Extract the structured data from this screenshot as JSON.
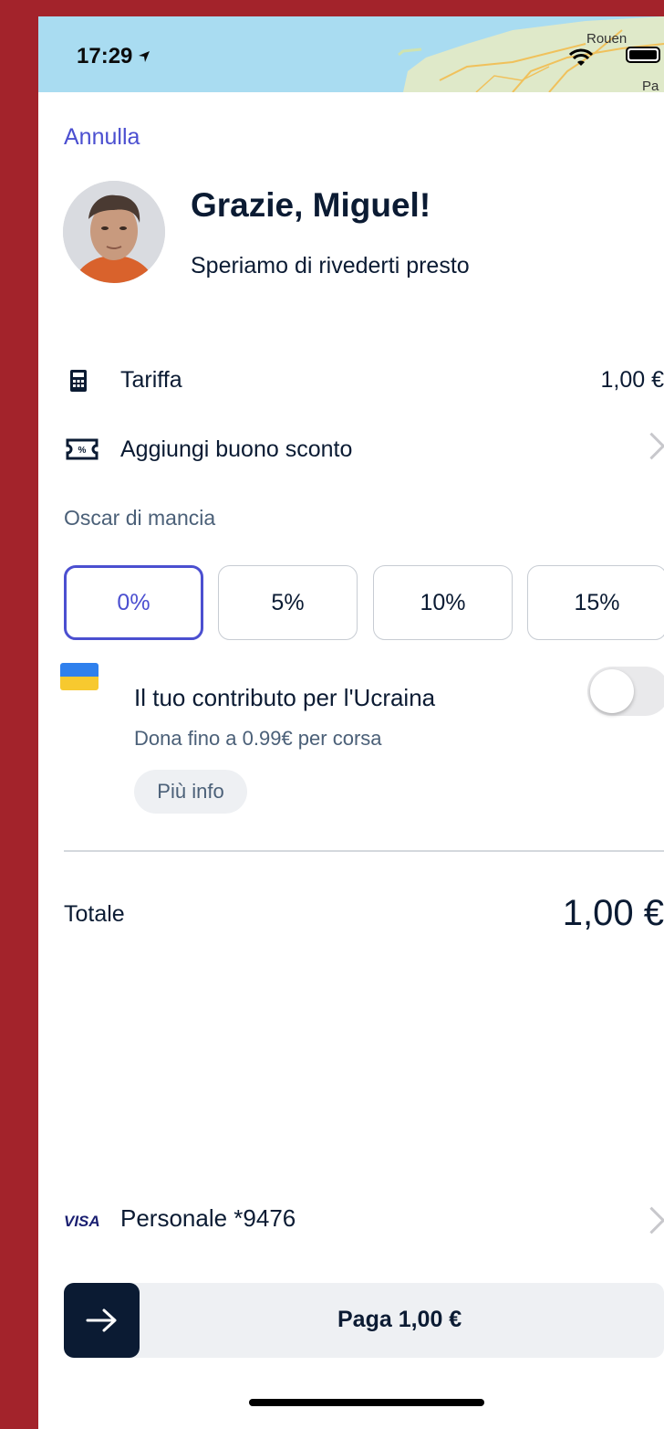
{
  "status_bar": {
    "time": "17:29",
    "map_labels": {
      "city": "Rouen",
      "partial": "Pa"
    }
  },
  "header": {
    "cancel_label": "Annulla",
    "title": "Grazie, Miguel!",
    "subtitle": "Speriamo di rivederti presto"
  },
  "fare": {
    "label": "Tariffa",
    "value": "1,00 €"
  },
  "voucher": {
    "label": "Aggiungi buono sconto"
  },
  "tip": {
    "label": "Oscar di mancia",
    "options": [
      "0%",
      "5%",
      "10%",
      "15%"
    ],
    "selected": "0%"
  },
  "donation": {
    "title": "Il tuo contributo per l'Ucraina",
    "subtitle": "Dona fino a 0.99€ per corsa",
    "more_info": "Più info",
    "enabled": false
  },
  "total": {
    "label": "Totale",
    "value": "1,00 €"
  },
  "payment": {
    "card_brand": "VISA",
    "card_label": "Personale *9476",
    "pay_label": "Paga 1,00 €"
  },
  "colors": {
    "accent": "#4b4fd0",
    "text": "#0b1b33",
    "background_frame": "#a3232b",
    "ukraine_blue": "#2f80ed",
    "ukraine_yellow": "#f7c92f"
  },
  "icons": [
    "location-arrow-icon",
    "wifi-icon",
    "battery-icon",
    "calculator-icon",
    "voucher-icon",
    "chevron-right-icon",
    "ukraine-flag-icon",
    "visa-logo",
    "arrow-right-icon"
  ]
}
